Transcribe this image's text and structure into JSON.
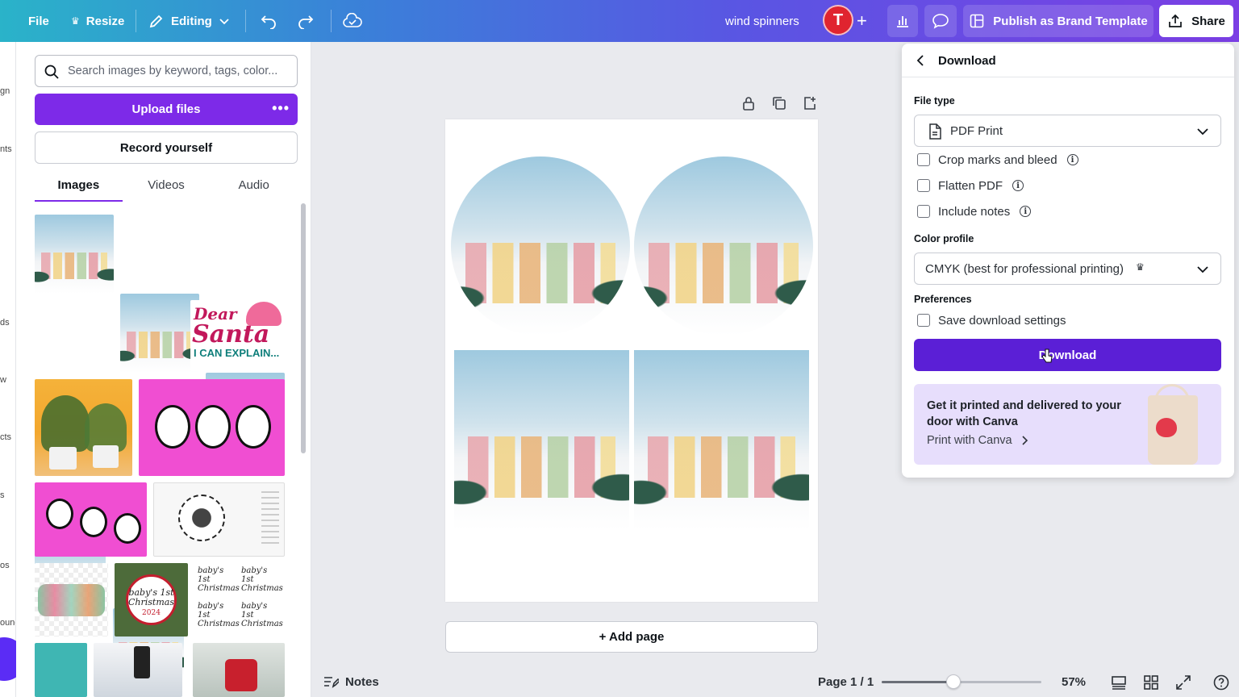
{
  "topbar": {
    "file": "File",
    "resize": "Resize",
    "editing": "Editing",
    "doc_title": "wind spinners",
    "avatar_initial": "T",
    "publish": "Publish as Brand Template",
    "share": "Share"
  },
  "rail": {
    "labels": [
      "gn",
      "nts",
      "ds",
      "w",
      "cts",
      "s",
      "os",
      "ound"
    ]
  },
  "panel": {
    "search_placeholder": "Search images by keyword, tags, color...",
    "upload": "Upload files",
    "upload_more": "•••",
    "record": "Record yourself",
    "tabs": [
      "Images",
      "Videos",
      "Audio"
    ],
    "active_tab": "Images",
    "thumb_texts": {
      "dear_santa_line1": "Dear",
      "dear_santa_line2": "Santa",
      "dear_santa_line3": "I CAN EXPLAIN...",
      "baby_christmas": "baby's 1st Christmas",
      "baby_year": "2024"
    }
  },
  "canvas": {
    "add_page": "+ Add page"
  },
  "bottom": {
    "notes": "Notes",
    "page_indicator": "Page 1 / 1",
    "zoom": "57%",
    "zoom_level": 0.45
  },
  "download": {
    "title": "Download",
    "file_type_label": "File type",
    "file_type_value": "PDF Print",
    "options": [
      "Crop marks and bleed",
      "Flatten PDF",
      "Include notes"
    ],
    "color_profile_label": "Color profile",
    "color_profile_value": "CMYK (best for professional printing)",
    "preferences_label": "Preferences",
    "save_settings": "Save download settings",
    "button": "Download",
    "promo_text": "Get it printed and delivered to your door with Canva",
    "promo_link": "Print with Canva"
  },
  "colors": {
    "accent": "#7d2ae8",
    "download_button": "#5b1fd6",
    "avatar": "#e0242f",
    "promo_bg": "#e7defc"
  }
}
